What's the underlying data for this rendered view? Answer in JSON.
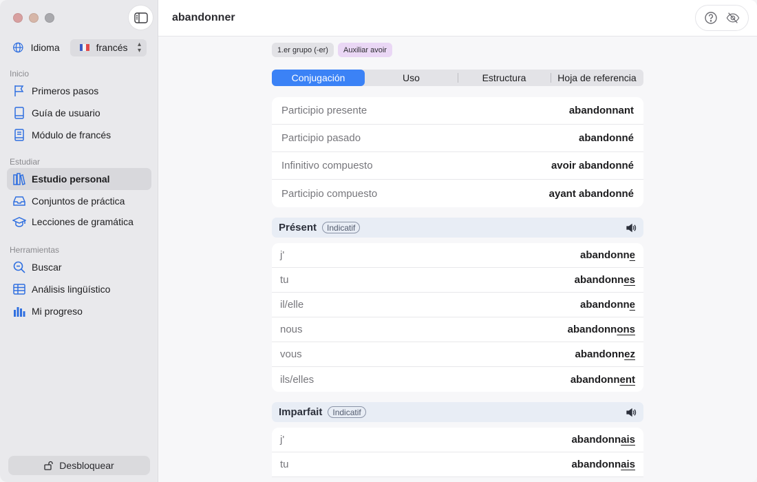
{
  "window": {
    "title": "abandonner"
  },
  "sidebar": {
    "language_label": "Idioma",
    "language_value": "francés",
    "sections": [
      {
        "heading": "Inicio",
        "items": [
          {
            "label": "Primeros pasos",
            "icon": "flag-icon"
          },
          {
            "label": "Guía de usuario",
            "icon": "book-icon"
          },
          {
            "label": "Módulo de francés",
            "icon": "book-text-icon"
          }
        ]
      },
      {
        "heading": "Estudiar",
        "items": [
          {
            "label": "Estudio personal",
            "icon": "books-icon",
            "active": true
          },
          {
            "label": "Conjuntos de práctica",
            "icon": "tray-icon"
          },
          {
            "label": "Lecciones de gramática",
            "icon": "graduation-cap-icon"
          }
        ]
      },
      {
        "heading": "Herramientas",
        "items": [
          {
            "label": "Buscar",
            "icon": "magnifier-icon"
          },
          {
            "label": "Análisis lingüístico",
            "icon": "table-icon"
          },
          {
            "label": "Mi progreso",
            "icon": "bar-chart-icon"
          }
        ]
      }
    ],
    "unlock_label": "Desbloquear"
  },
  "tags": [
    "1.er grupo (-er)",
    "Auxiliar avoir"
  ],
  "tabs": [
    "Conjugación",
    "Uso",
    "Estructura",
    "Hoja de referencia"
  ],
  "active_tab": 0,
  "participles": [
    {
      "label": "Participio presente",
      "value": "abandonnant"
    },
    {
      "label": "Participio pasado",
      "value": "abandonné"
    },
    {
      "label": "Infinitivo compuesto",
      "value": "avoir abandonné"
    },
    {
      "label": "Participio compuesto",
      "value": "ayant abandonné"
    }
  ],
  "tenses": [
    {
      "name": "Présent",
      "mood": "Indicatif",
      "rows": [
        {
          "pronoun": "j'",
          "stem": "abandonn",
          "ending": "e"
        },
        {
          "pronoun": "tu",
          "stem": "abandonn",
          "ending": "es"
        },
        {
          "pronoun": "il/elle",
          "stem": "abandonn",
          "ending": "e"
        },
        {
          "pronoun": "nous",
          "stem": "abandonn",
          "ending": "ons"
        },
        {
          "pronoun": "vous",
          "stem": "abandonn",
          "ending": "ez"
        },
        {
          "pronoun": "ils/elles",
          "stem": "abandonn",
          "ending": "ent"
        }
      ]
    },
    {
      "name": "Imparfait",
      "mood": "Indicatif",
      "rows": [
        {
          "pronoun": "j'",
          "stem": "abandonn",
          "ending": "ais"
        },
        {
          "pronoun": "tu",
          "stem": "abandonn",
          "ending": "ais"
        }
      ]
    }
  ],
  "colors": {
    "accent": "#3b82f6",
    "icon_blue": "#2f6fe0",
    "tag_purple": "#ead7f5",
    "tense_header": "#e8edf5"
  }
}
